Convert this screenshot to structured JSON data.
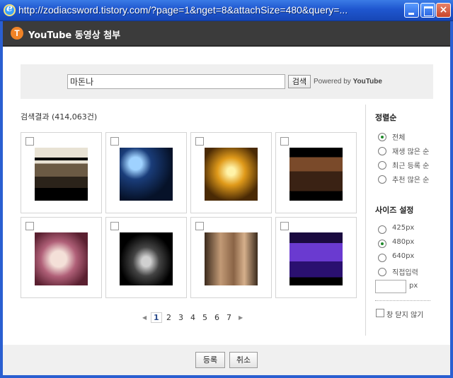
{
  "window": {
    "title": "http://zodiacsword.tistory.com/?page=1&nget=8&attachSize=480&query=..."
  },
  "header": {
    "logo_letter": "T",
    "title": "YouTube 동영상 첨부"
  },
  "search": {
    "value": "마돈나",
    "button_label": "검색",
    "powered_prefix": "Powered by ",
    "powered_brand": "YouTube"
  },
  "results": {
    "count_label": "검색결과 (414,063건)",
    "thumbnails": [
      {
        "scene": "group-on-stage",
        "checked": false
      },
      {
        "scene": "blue-concert-stage",
        "checked": false
      },
      {
        "scene": "golden-spotlight-dancer",
        "checked": false
      },
      {
        "scene": "dim-room-performers",
        "checked": false
      },
      {
        "scene": "portrait-in-white",
        "checked": false
      },
      {
        "scene": "dark-dancers",
        "checked": false
      },
      {
        "scene": "bellies-closeup",
        "checked": false
      },
      {
        "scene": "purple-stage-show",
        "checked": false
      }
    ]
  },
  "pagination": {
    "pages": [
      "1",
      "2",
      "3",
      "4",
      "5",
      "6",
      "7"
    ],
    "current": "1"
  },
  "sort": {
    "title": "정렬순",
    "options": [
      "전체",
      "재생 많은 순",
      "최근 등록 순",
      "추천 많은 순"
    ],
    "selected": 0
  },
  "size": {
    "title": "사이즈 설정",
    "options": [
      "425px",
      "480px",
      "640px",
      "직접입력"
    ],
    "selected": 1,
    "custom_unit": "px"
  },
  "keep_open": {
    "label": "창 닫지 않기",
    "checked": false
  },
  "footer": {
    "ok_label": "등록",
    "cancel_label": "취소"
  },
  "colors": {
    "titlebar": "#1f56cf",
    "header": "#3b3b3b",
    "logo": "#f08326",
    "radio_selected": "#1f8a2a"
  }
}
